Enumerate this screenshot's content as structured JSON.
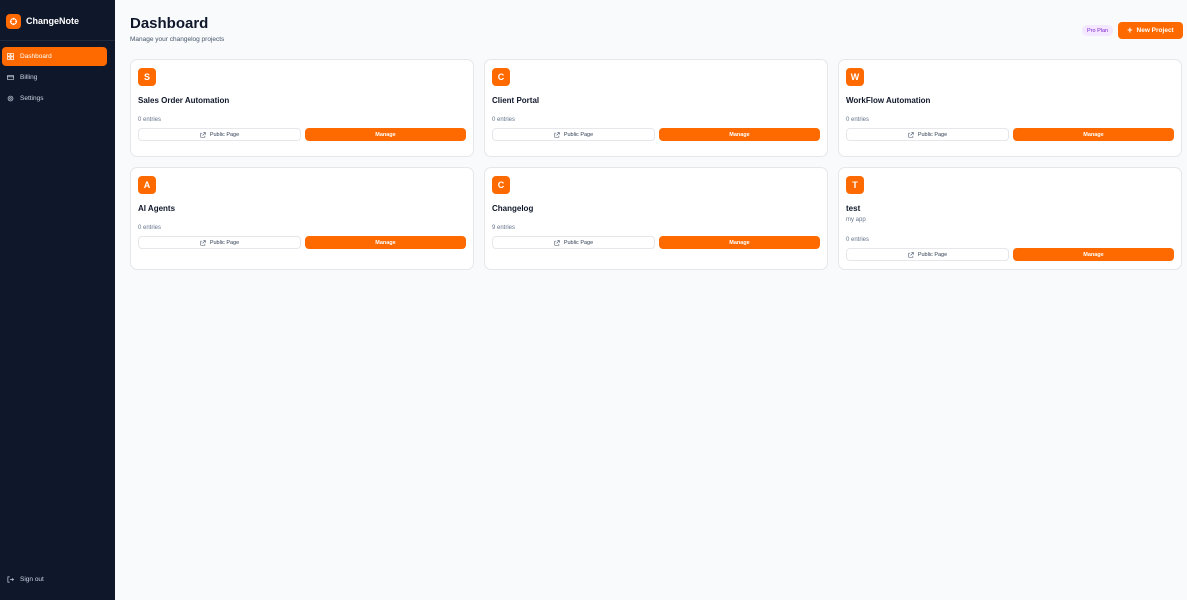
{
  "app": {
    "name": "ChangeNote",
    "accent": "#ff6a00",
    "sidebar_bg": "#0f172a"
  },
  "sidebar": {
    "items": [
      {
        "label": "Dashboard",
        "icon": "dashboard-grid-icon",
        "active": true
      },
      {
        "label": "Billing",
        "icon": "credit-card-icon",
        "active": false
      },
      {
        "label": "Settings",
        "icon": "gear-icon",
        "active": false
      }
    ],
    "signout_label": "Sign out"
  },
  "header": {
    "title": "Dashboard",
    "subtitle": "Manage your changelog projects",
    "plan_badge": "Pro Plan",
    "new_project_label": "New Project"
  },
  "projects": [
    {
      "initial": "S",
      "name": "Sales Order Automation",
      "description": "",
      "entries": "0 entries",
      "public_label": "Public Page",
      "manage_label": "Manage"
    },
    {
      "initial": "C",
      "name": "Client Portal",
      "description": "",
      "entries": "0 entries",
      "public_label": "Public Page",
      "manage_label": "Manage"
    },
    {
      "initial": "W",
      "name": "WorkFlow Automation",
      "description": "",
      "entries": "0 entries",
      "public_label": "Public Page",
      "manage_label": "Manage"
    },
    {
      "initial": "A",
      "name": "AI Agents",
      "description": "",
      "entries": "0 entries",
      "public_label": "Public Page",
      "manage_label": "Manage"
    },
    {
      "initial": "C",
      "name": "Changelog",
      "description": "",
      "entries": "9 entries",
      "public_label": "Public Page",
      "manage_label": "Manage"
    },
    {
      "initial": "T",
      "name": "test",
      "description": "my app",
      "entries": "0 entries",
      "public_label": "Public Page",
      "manage_label": "Manage"
    }
  ]
}
